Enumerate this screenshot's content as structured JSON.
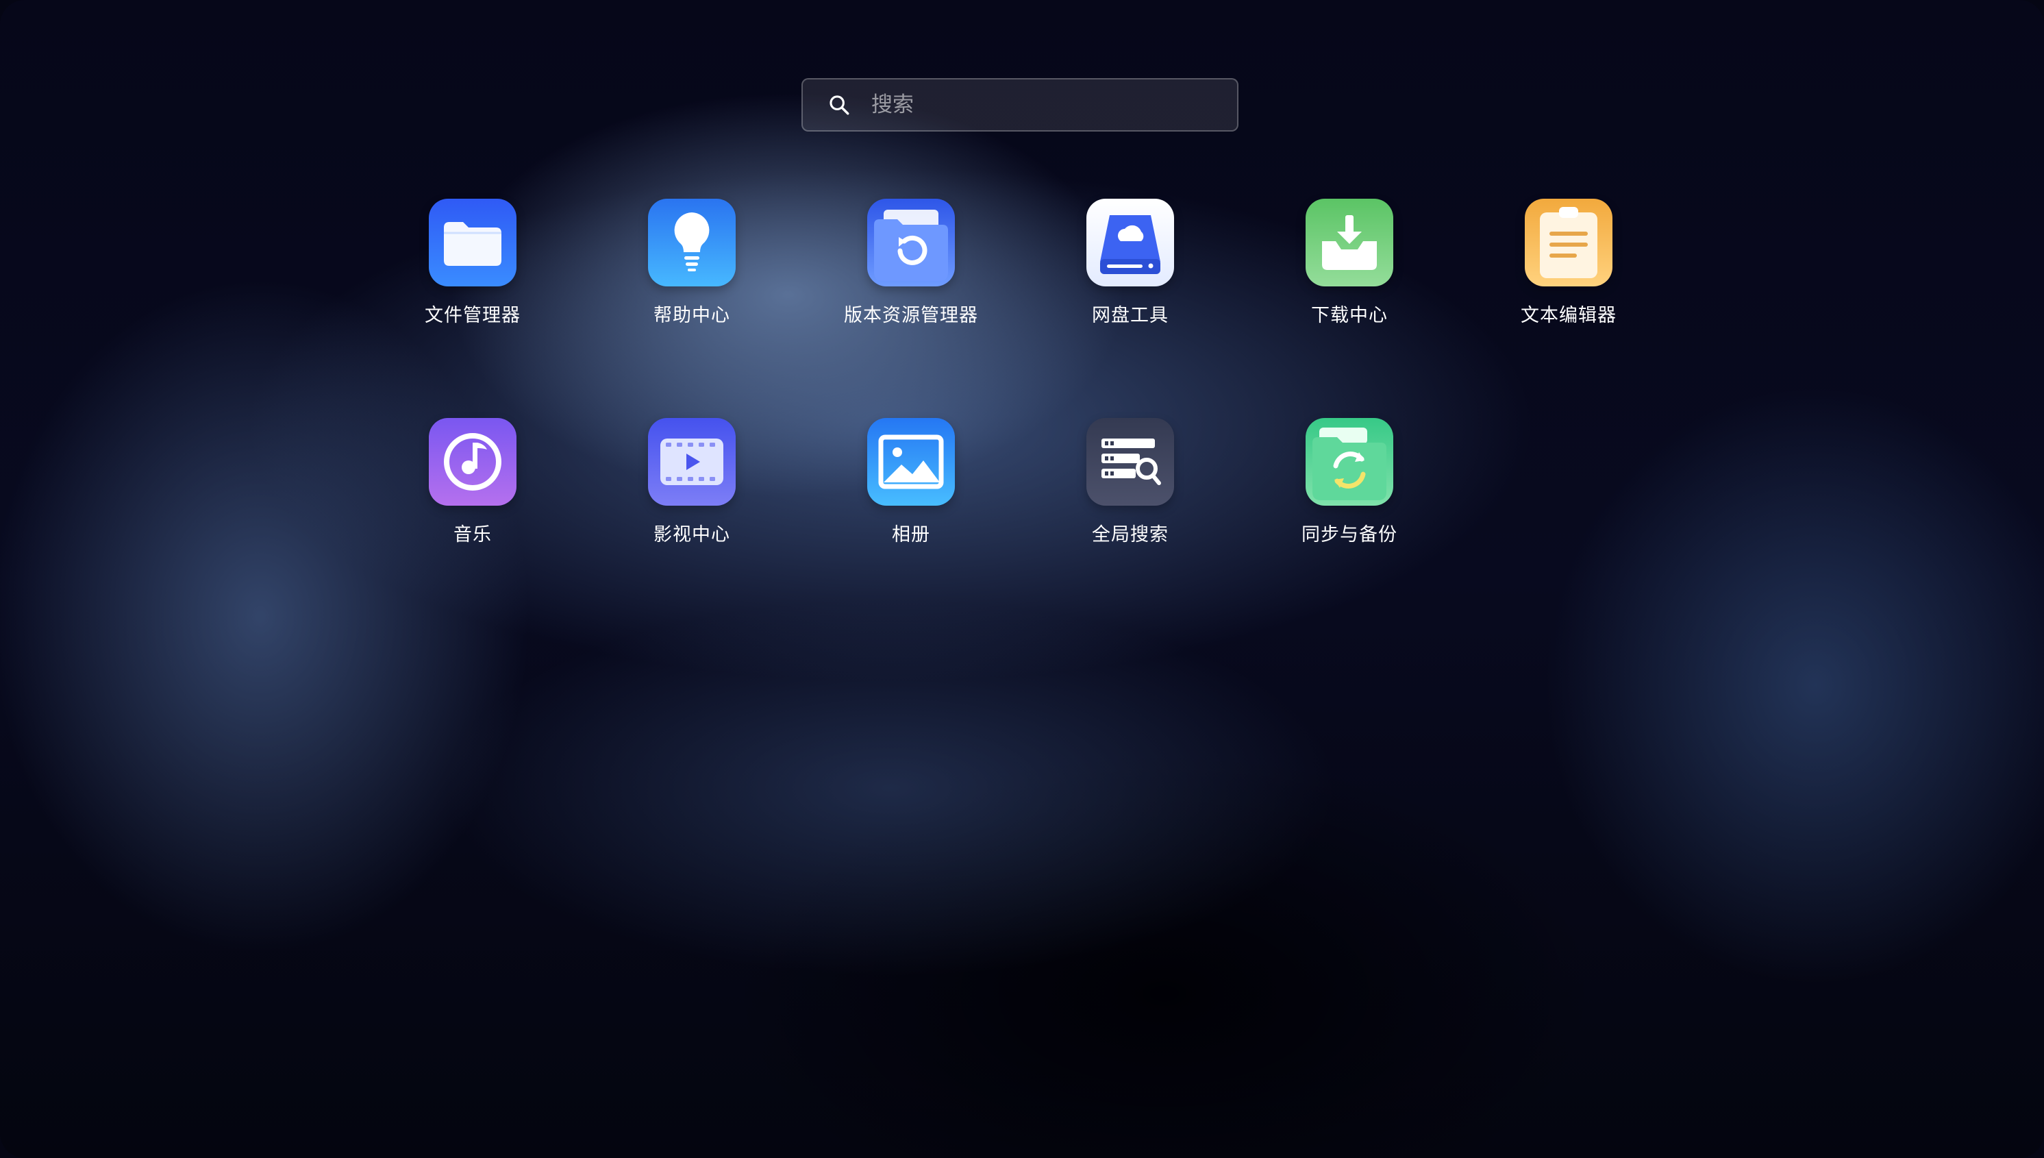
{
  "search": {
    "placeholder": "搜索",
    "icon": "search-icon"
  },
  "apps": [
    {
      "id": "file-manager",
      "label": "文件管理器",
      "icon": "folder-icon",
      "color_top": "#3a63ff",
      "color_bottom": "#2f8bff"
    },
    {
      "id": "help-center",
      "label": "帮助中心",
      "icon": "lightbulb-icon",
      "color_top": "#2f7cf3",
      "color_bottom": "#45b6ff"
    },
    {
      "id": "version-resource-manager",
      "label": "版本资源管理器",
      "icon": "folder-restore-icon",
      "color_top": "#3a6df7",
      "color_bottom": "#6aa0ff"
    },
    {
      "id": "disk-tool",
      "label": "网盘工具",
      "icon": "cloud-drive-icon",
      "color_top": "#ffffff",
      "color_bottom": "#dbe6ff"
    },
    {
      "id": "download-center",
      "label": "下载中心",
      "icon": "download-tray-icon",
      "color_top": "#5fc96b",
      "color_bottom": "#8fdc98"
    },
    {
      "id": "text-editor",
      "label": "文本编辑器",
      "icon": "clipboard-notes-icon",
      "color_top": "#f6b650",
      "color_bottom": "#ffd07a"
    },
    {
      "id": "music",
      "label": "音乐",
      "icon": "music-note-icon",
      "color_top": "#7b5cf3",
      "color_bottom": "#b36ff0"
    },
    {
      "id": "video-center",
      "label": "影视中心",
      "icon": "film-play-icon",
      "color_top": "#4b58f0",
      "color_bottom": "#7b7bf5"
    },
    {
      "id": "album",
      "label": "相册",
      "icon": "picture-icon",
      "color_top": "#2c7ff6",
      "color_bottom": "#43b9ff"
    },
    {
      "id": "global-search",
      "label": "全局搜索",
      "icon": "list-search-icon",
      "color_top": "#3a4056",
      "color_bottom": "#4b5068"
    },
    {
      "id": "sync-backup",
      "label": "同步与备份",
      "icon": "folder-sync-icon",
      "color_top": "#3fcf8d",
      "color_bottom": "#7be0a8"
    }
  ]
}
